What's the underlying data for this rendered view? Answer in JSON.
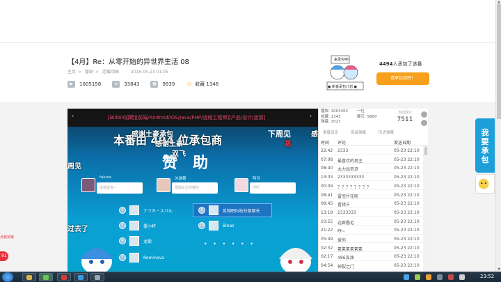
{
  "video": {
    "title": "【4月】Re：从零开始的异世界生活 08",
    "breadcrumb": [
      "主页",
      "番剧",
      "连载动画"
    ],
    "date": "2016-05-23 01:05",
    "plays": "1005158",
    "danmaku_count": "33843",
    "coins": "9939",
    "favorite_label": "收藏 1346"
  },
  "promo": {
    "mascot_sign_top": "来承包吧！",
    "mascot_sign_bottom": "● 新番承包计划 ●",
    "count_number": "4494",
    "count_text": "人承包了该番",
    "button_label": "请承包我吧！"
  },
  "player": {
    "prev_arrow": "‹",
    "next_arrow": "›",
    "top_link": "[Bilibili招聘][前端/Android/iOS/Java/PHP/运维工程师][产品/设计/运营]",
    "scene_title": "本番由   494 位承包商",
    "scene_title_right": "下周见",
    "big_text": "赞助",
    "danmaku": [
      {
        "text": "感谢土豪承包"
      },
      {
        "text": "感谢土豪"
      },
      {
        "text": "双飞"
      },
      {
        "text": "蒸"
      },
      {
        "text": "周见"
      },
      {
        "text": "过去了"
      },
      {
        "text": "感"
      }
    ],
    "sponsors": [
      {
        "name": "faluna",
        "message": "没有留言~"
      },
      {
        "name": "沐渊著",
        "message": "雷姆女主苏菜往"
      },
      {
        "name": "阿月",
        "message": "(lol)"
      }
    ],
    "ranking": [
      {
        "num": "4",
        "name": "ナツキ・スバル"
      },
      {
        "num": "5",
        "name": "墨小杯"
      },
      {
        "num": "6",
        "name": "龙歌"
      },
      {
        "num": "7",
        "name": "Reminova"
      },
      {
        "num": "8",
        "name": "反相吧lb站分部部长"
      },
      {
        "num": "10",
        "name": "Binas"
      }
    ],
    "dots": "• • • • • •"
  },
  "sidebar": {
    "stats_left": [
      "播放: 1003402",
      "收藏: 1343",
      "弹幕: 3027"
    ],
    "stats_right": [
      "一位",
      "硬币: 9900",
      ""
    ],
    "online_label": "当前观众",
    "online_value": "7511",
    "tools": [
      "屏蔽设定",
      "高级弹幕",
      "历史弹幕"
    ],
    "head_time": "时间",
    "head_comment": "评论",
    "head_date": "发送日期",
    "rows": [
      {
        "time": "22:42",
        "comment": "2333",
        "date": "05-23 22:10"
      },
      {
        "time": "07:08",
        "comment": "最喜欢的男主",
        "date": "05-23 22:10"
      },
      {
        "time": "08:40",
        "comment": "太力出奇迹",
        "date": "05-23 22:10"
      },
      {
        "time": "13:03",
        "comment": "2333333333",
        "date": "05-23 22:10"
      },
      {
        "time": "00:09",
        "comment": "？？？？？？？？",
        "date": "05-23 22:10"
      },
      {
        "time": "08:41",
        "comment": "雷宝片花呢",
        "date": "05-23 22:10"
      },
      {
        "time": "08:45",
        "date": "05-23 22:10",
        "comment": "看错千"
      },
      {
        "time": "13:18",
        "comment": "2333333",
        "date": "05-23 22:10"
      },
      {
        "time": "10:55",
        "comment": "这群蠢毛",
        "date": "05-23 22:10"
      },
      {
        "time": "21:22",
        "comment": "哼~",
        "date": "05-23 22:10"
      },
      {
        "time": "05:49",
        "comment": "爱你",
        "date": "05-23 22:10"
      },
      {
        "time": "02:32",
        "comment": "氪氪氪氪氪氪",
        "date": "05-23 22:10"
      },
      {
        "time": "02:17",
        "comment": "486加油",
        "date": "05-23 22:10"
      },
      {
        "time": "04:54",
        "comment": "神裂之门",
        "date": "05-23 22:10"
      }
    ]
  },
  "fab": {
    "label_line1": "我",
    "label_line2": "要",
    "label_line3": "承",
    "label_line4": "包"
  },
  "left_badge": {
    "text": "点我加速",
    "num": "91"
  },
  "taskbar": {
    "clock": "23:52"
  },
  "colors": {
    "accent": "#f6a01b",
    "bilibili_blue": "#1e9fd9",
    "pink_link": "#e8436b"
  }
}
